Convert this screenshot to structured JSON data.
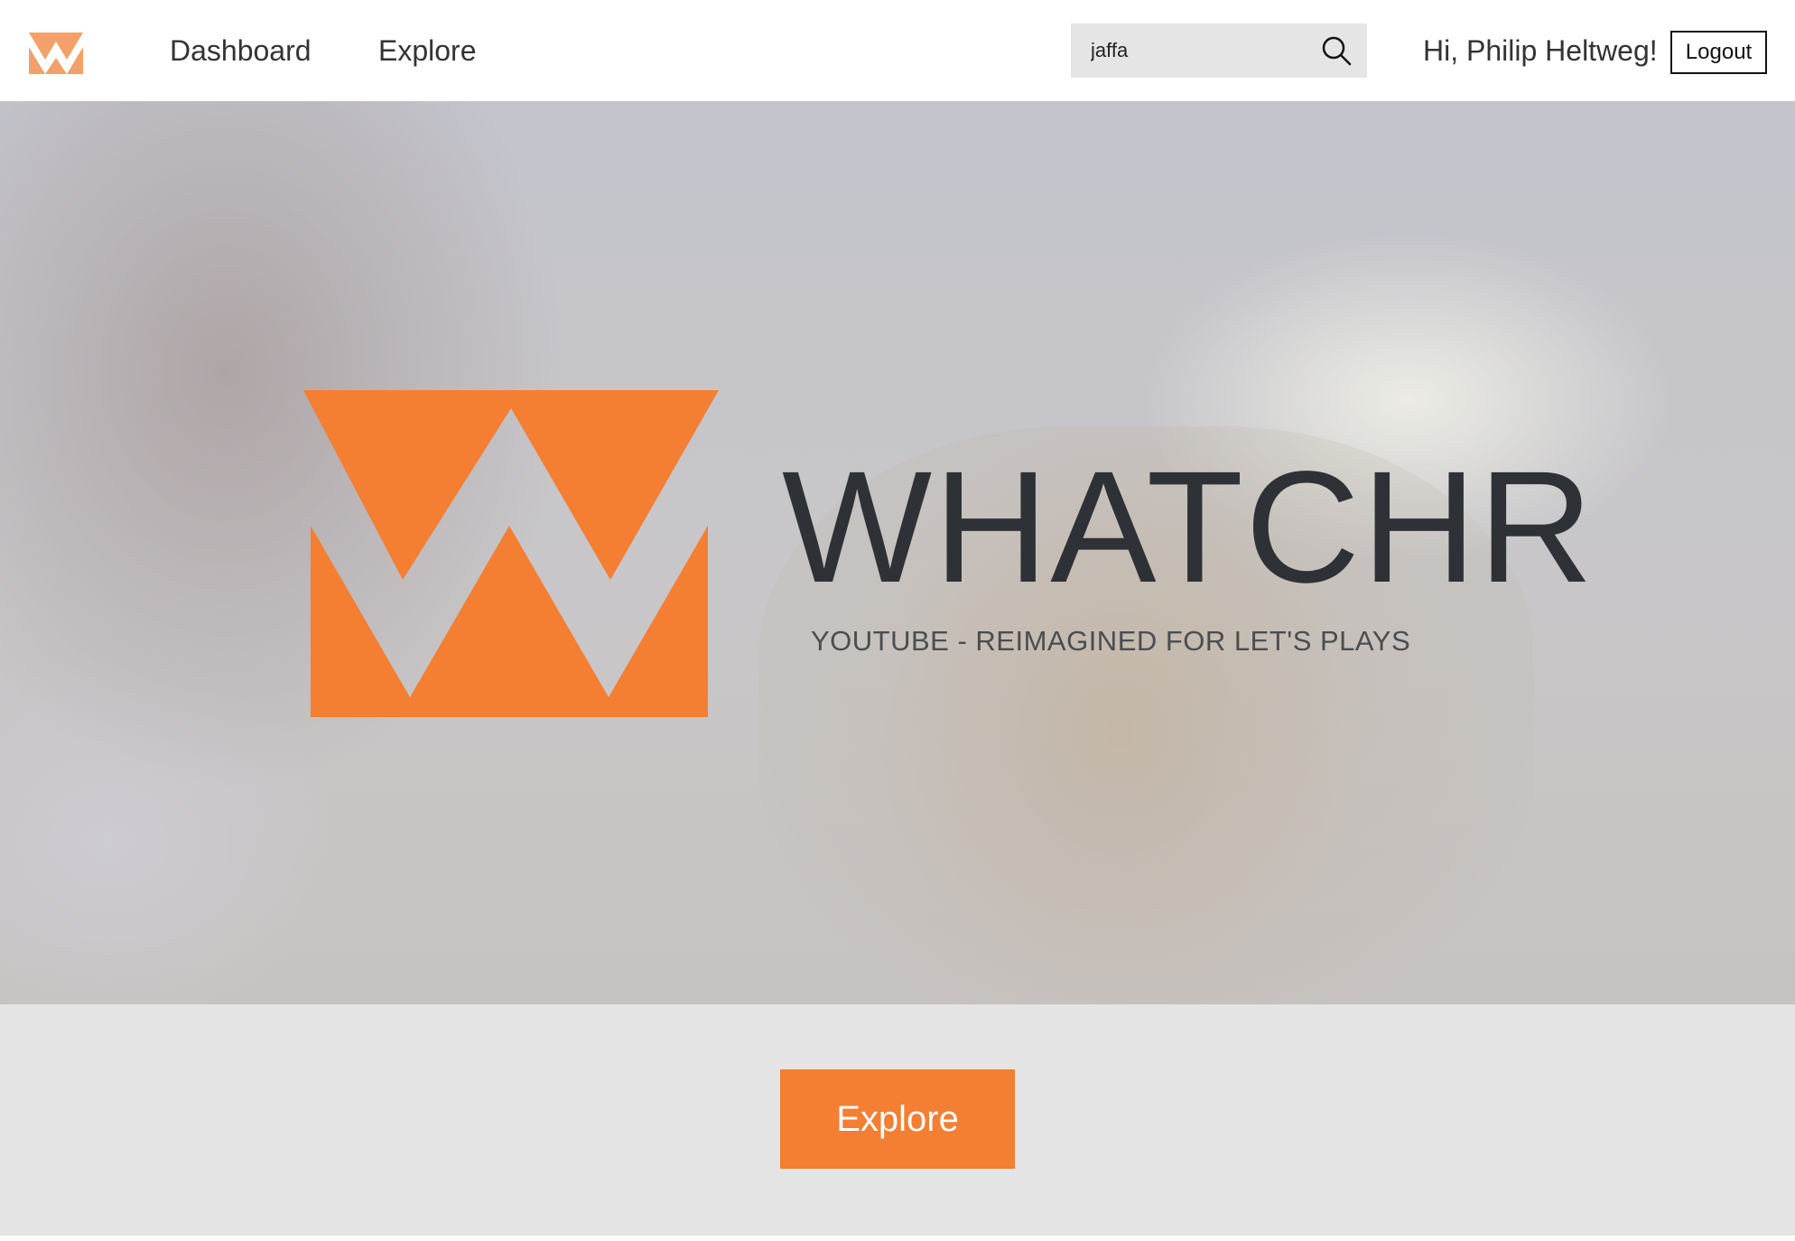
{
  "nav": {
    "links": [
      "Dashboard",
      "Explore"
    ]
  },
  "search": {
    "value": "jaffa"
  },
  "user": {
    "greeting": "Hi, Philip Heltweg!",
    "logout_label": "Logout"
  },
  "hero": {
    "title": "WHATCHR",
    "tagline": "YOUTUBE - REIMAGINED FOR LET'S PLAYS"
  },
  "cta": {
    "label": "Explore"
  },
  "colors": {
    "brand_orange": "#f47e32",
    "title_dark": "#2e3236",
    "band_gray": "#e4e4e4"
  },
  "icons": {
    "logo": "whatchr-w-logo",
    "search": "search-icon"
  }
}
